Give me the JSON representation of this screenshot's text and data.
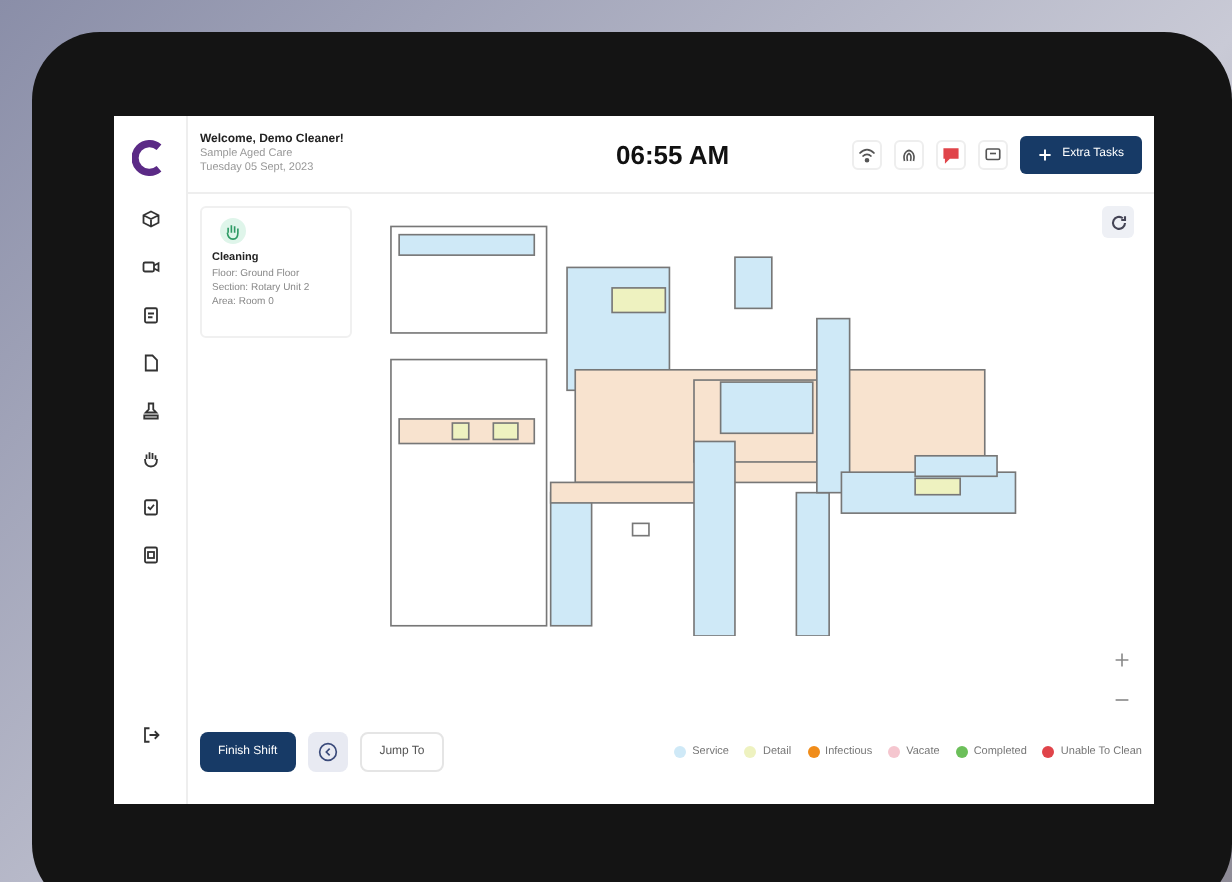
{
  "header": {
    "welcome": "Welcome, Demo Cleaner!",
    "facility": "Sample Aged Care",
    "date": "Tuesday 05 Sept, 2023",
    "time": "06:55 AM",
    "extra_tasks_button": "Extra Tasks"
  },
  "header_icons": [
    {
      "kind": "wifi"
    },
    {
      "kind": "fingerprint"
    },
    {
      "kind": "chat"
    },
    {
      "kind": "message"
    }
  ],
  "sidebar": {
    "items": [
      {
        "kind": "cube"
      },
      {
        "kind": "video"
      },
      {
        "kind": "clipboard"
      },
      {
        "kind": "file"
      },
      {
        "kind": "stamp"
      },
      {
        "kind": "hand"
      },
      {
        "kind": "checklist"
      },
      {
        "kind": "report"
      },
      {
        "kind": "logout"
      }
    ]
  },
  "task_card": {
    "title": "Cleaning",
    "lines": [
      "Floor: Ground Floor",
      "Section: Rotary Unit 2",
      "Area: Room 0"
    ]
  },
  "footer": {
    "finish_button": "Finish Shift",
    "jump_button": "Jump To"
  },
  "legend": [
    {
      "label": "Service",
      "color": "#cfe9f7"
    },
    {
      "label": "Detail",
      "color": "#eef2c0"
    },
    {
      "label": "Infectious",
      "color": "#f08c1a"
    },
    {
      "label": "Vacate",
      "color": "#f5c6cf"
    },
    {
      "label": "Completed",
      "color": "#6cbf5a"
    },
    {
      "label": "Unable To Clean",
      "color": "#e0444a"
    }
  ]
}
